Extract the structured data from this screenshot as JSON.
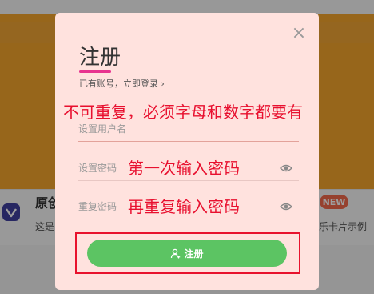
{
  "background": {
    "card_title": "原创",
    "card_desc": "这是",
    "badge": "NEW",
    "card_desc_right": "乐卡片示例"
  },
  "modal": {
    "title": "注册",
    "login_link": "已有账号，立即登录 ›",
    "close_symbol": "×",
    "username_placeholder": "设置用户名",
    "password_placeholder": "设置密码",
    "confirm_placeholder": "重复密码",
    "submit_label": "注册",
    "accent_color": "#e8338f"
  },
  "annotations": {
    "username_note": "不可重复，必须字母和数字都要有",
    "password_note": "第一次输入密码",
    "confirm_note": "再重复输入密码",
    "color": "#e8102f"
  }
}
